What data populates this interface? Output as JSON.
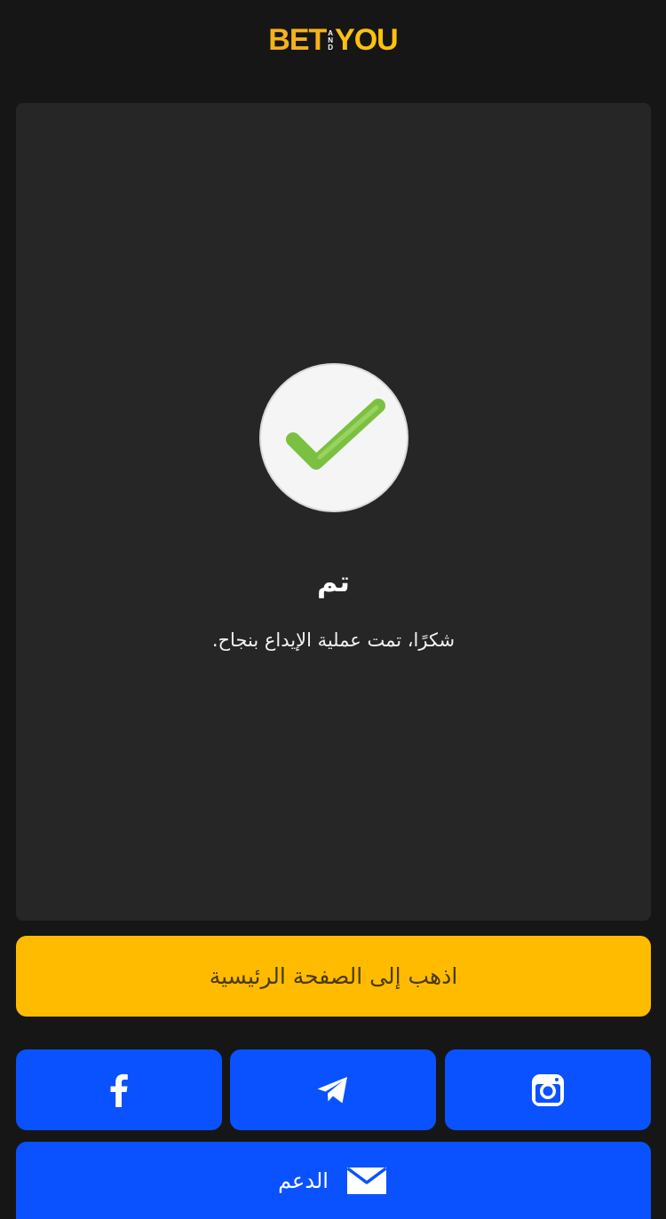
{
  "header": {
    "logo": {
      "part1": "BET",
      "and": [
        "A",
        "N",
        "D"
      ],
      "part2": "YOU"
    }
  },
  "status": {
    "title": "تم",
    "message": "شكرًا، تمت عملية الإيداع بنجاح."
  },
  "actions": {
    "home_label": "اذهب إلى الصفحة الرئيسية",
    "support_label": "الدعم"
  },
  "social": [
    {
      "icon": "facebook-icon"
    },
    {
      "icon": "telegram-icon"
    },
    {
      "icon": "instagram-icon"
    }
  ],
  "colors": {
    "background": "#161616",
    "card": "#262626",
    "accent_yellow": "#ffbb00",
    "button_blue": "#0a52ff",
    "check_green": "#7ac142"
  }
}
